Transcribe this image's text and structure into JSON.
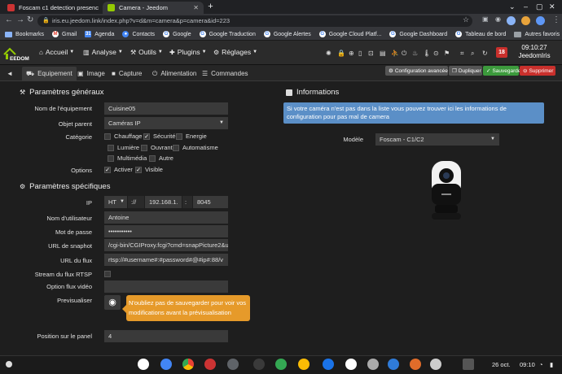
{
  "browser": {
    "tabs": [
      {
        "title": "Foscam c1 detection presence",
        "active": false
      },
      {
        "title": "Camera - Jeedom",
        "active": true
      }
    ],
    "url": "iris.eu.jeedom.link/index.php?v=d&m=camera&p=camera&id=223",
    "bookmarks": [
      {
        "label": "Bookmarks",
        "icon": "star-grid-icon"
      },
      {
        "label": "Gmail",
        "icon": "gmail-icon"
      },
      {
        "label": "Agenda",
        "icon": "calendar-icon"
      },
      {
        "label": "Contacts",
        "icon": "contacts-icon"
      },
      {
        "label": "Google",
        "icon": "google-icon"
      },
      {
        "label": "Google Traduction",
        "icon": "google-icon"
      },
      {
        "label": "Google Alertes",
        "icon": "google-icon"
      },
      {
        "label": "Google Cloud Platf...",
        "icon": "google-icon"
      },
      {
        "label": "Google Dashboard",
        "icon": "google-icon"
      },
      {
        "label": "Tableau de bord",
        "icon": "google-icon"
      }
    ],
    "other_bookmarks": "Autres favoris"
  },
  "jeedom": {
    "menu": [
      {
        "label": "Accueil",
        "icon": "home-icon"
      },
      {
        "label": "Analyse",
        "icon": "chart-icon"
      },
      {
        "label": "Outils",
        "icon": "wrench-icon"
      },
      {
        "label": "Plugins",
        "icon": "puzzle-icon"
      },
      {
        "label": "Réglages",
        "icon": "gears-icon"
      }
    ],
    "notifications": "18",
    "time": "09:10:27",
    "user": "JeedomIris"
  },
  "subtabs": [
    {
      "label": "Equipement",
      "icon": "car-icon",
      "active": true
    },
    {
      "label": "Image",
      "icon": "image-icon",
      "active": false
    },
    {
      "label": "Capture",
      "icon": "video-icon",
      "active": false
    },
    {
      "label": "Alimentation",
      "icon": "power-icon",
      "active": false
    },
    {
      "label": "Commandes",
      "icon": "list-icon",
      "active": false
    }
  ],
  "actions": {
    "advanced": "Configuration avancée",
    "duplicate": "Dupliquer",
    "save": "Sauvegarder",
    "delete": "Supprimer"
  },
  "general": {
    "title": "Paramètres généraux",
    "name_label": "Nom de l'équipement",
    "name_value": "Cuisine05",
    "parent_label": "Objet parent",
    "parent_value": "Caméras IP",
    "category_label": "Catégorie",
    "categories": [
      {
        "label": "Chauffage",
        "checked": false
      },
      {
        "label": "Sécurité",
        "checked": true
      },
      {
        "label": "Energie",
        "checked": false
      },
      {
        "label": "Lumière",
        "checked": false
      },
      {
        "label": "Ouvrant",
        "checked": false
      },
      {
        "label": "Automatisme",
        "checked": false
      },
      {
        "label": "Multimédia",
        "checked": false
      },
      {
        "label": "Autre",
        "checked": false
      }
    ],
    "options_label": "Options",
    "options": [
      {
        "label": "Activer",
        "checked": true
      },
      {
        "label": "Visible",
        "checked": true
      }
    ]
  },
  "specific": {
    "title": "Paramètres spécifiques",
    "ip_label": "IP",
    "protocol": "HT",
    "sep": "://",
    "ip_value": "192.168.1.",
    "colon": ":",
    "port": "8045",
    "user_label": "Nom d'utilisateur",
    "user_value": "Antoine",
    "pass_label": "Mot de passe",
    "pass_value": "•••••••••••",
    "snap_label": "URL de snaphot",
    "snap_value": "/cgi-bin/CGIProxy.fcgi?cmd=snapPicture2&u",
    "flux_label": "URL du flux",
    "flux_value": "rtsp://#username#:#password#@#ip#:88/v",
    "rtsp_label": "Stream du flux RTSP",
    "video_label": "Option flux vidéo",
    "preview_label": "Previsualiser",
    "tooltip": "N'oubliez pas de sauvegarder pour voir vos modifications avant la prévisualisation",
    "position_label": "Position sur le panel",
    "position_value": "4"
  },
  "informations": {
    "title": "Informations",
    "notice": "Si votre caméra n'est pas dans la liste vous pouvez trouver ici les informations de configuration pour pas mal de camera",
    "model_label": "Modèle",
    "model_value": "Foscam - C1/C2"
  },
  "taskbar": {
    "date": "26 oct.",
    "time": "09:10"
  },
  "colors": {
    "save": "#3c9a3c",
    "delete": "#c9302c",
    "info": "#5b8fc7",
    "tooltip": "#e69a2a",
    "accent": "#94ca02"
  }
}
